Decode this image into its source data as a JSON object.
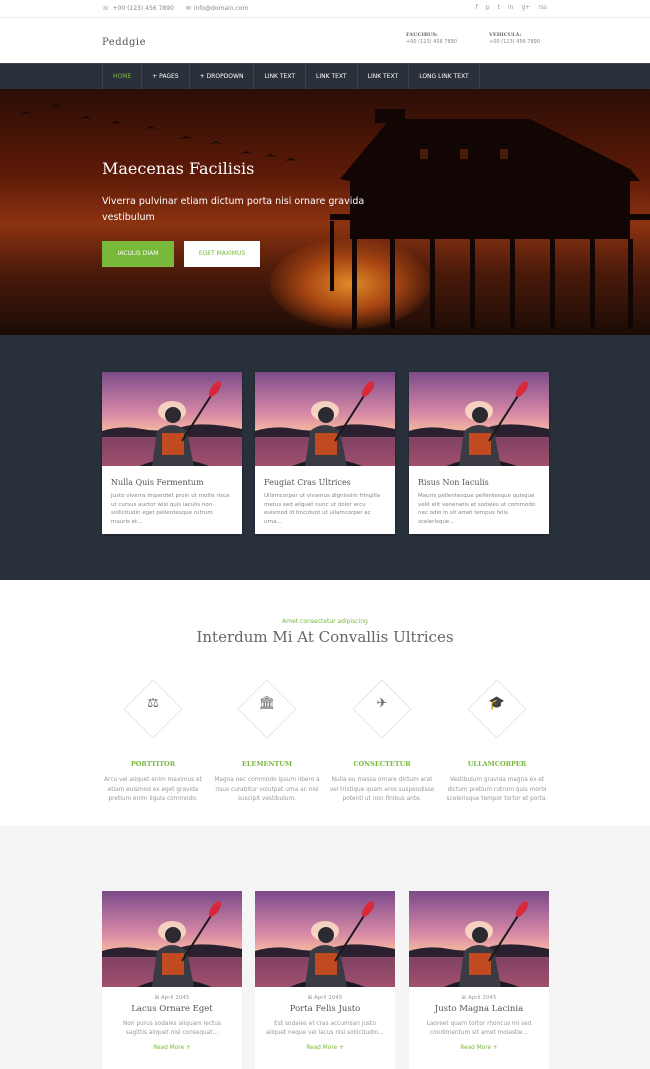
{
  "topbar": {
    "phone": "+00 (123) 456 7890",
    "email": "info@domain.com",
    "social": [
      "f",
      "p",
      "t",
      "in",
      "g+",
      "rss"
    ]
  },
  "header": {
    "logo": "Peddgie",
    "contact1": {
      "label": "FAUCIBUS:",
      "value": "+00 (123) 456 7890"
    },
    "contact2": {
      "label": "VEHICULA:",
      "value": "+00 (123) 456 7890"
    }
  },
  "nav": {
    "items": [
      "HOME",
      "+ PAGES",
      "+ DROPDOWN",
      "LINK TEXT",
      "LINK TEXT",
      "LINK TEXT",
      "LONG LINK TEXT"
    ]
  },
  "hero": {
    "title": "Maecenas Facilisis",
    "subtitle": "Viverra pulvinar etiam dictum porta nisi ornare gravida vestibulum",
    "btn_primary": "IACULIS DIAM",
    "btn_secondary": "EGET MAXIMUS"
  },
  "cards": [
    {
      "title": "Nulla Quis Fermentum",
      "text": "Justo viverra imperdiet proin ut mollis risus ut cursus auctor wisi quis iaculis non sollicitudin eget pellentesque rutrum mauris et..."
    },
    {
      "title": "Feugiat Cras Ultrices",
      "text": "Ullamcorper ut vivamus dignissim fringilla metus sed aliquet nunc ut dolor arcu euismod id tincidunt ut ullamcorper ac urna..."
    },
    {
      "title": "Risus Non Iaculis",
      "text": "Mauris pellentesque pellentesque quisque velit elit venenatis et sodales ut commodo nec odio in sit amet tempus felis scelerisque..."
    }
  ],
  "features": {
    "kicker": "Amet consectetur adipiscing",
    "title": "Interdum Mi At Convallis Ultrices",
    "items": [
      {
        "icon": "scale-icon",
        "title": "PORTTITOR",
        "text": "Arcu vel aliquet enim maximus et etiam euismod ex eget gravida pretium enim ligula commodo."
      },
      {
        "icon": "bank-icon",
        "title": "ELEMENTUM",
        "text": "Magna nec commodo ipsum libero a risus curabitur volutpat urna ac nisi suscipit vestibulum."
      },
      {
        "icon": "plane-icon",
        "title": "CONSECTETUR",
        "text": "Nulla eu massa ornare dictum erat vel tristique quam eros suspendisse potenti ut non finibus ante."
      },
      {
        "icon": "graduation-cap-icon",
        "title": "ULLAMCORPER",
        "text": "Vestibulum gravida magna ex et dictum pretium rutrum quis morbi scelerisque tempor tortor et porta."
      }
    ]
  },
  "blog": [
    {
      "date": "April 2045",
      "title": "Lacus Ornare Eget",
      "text": "Non purus sodales aliquam lectus sagittis aliquet nisl consequat...",
      "more": "Read More +"
    },
    {
      "date": "April 2045",
      "title": "Porta Felis Justo",
      "text": "Est sodales et cras accumsan justo aliquet neque vel lacus nisi sollicitudin...",
      "more": "Read More +"
    },
    {
      "date": "April 2045",
      "title": "Justo Magna Lacinia",
      "text": "Laoreet quam tortor rhoncus mi sed condimentum sit amet molestie...",
      "more": "Read More +"
    }
  ],
  "colors": {
    "accent": "#78b83a",
    "dark": "#28303b",
    "nav": "#2a313b"
  }
}
